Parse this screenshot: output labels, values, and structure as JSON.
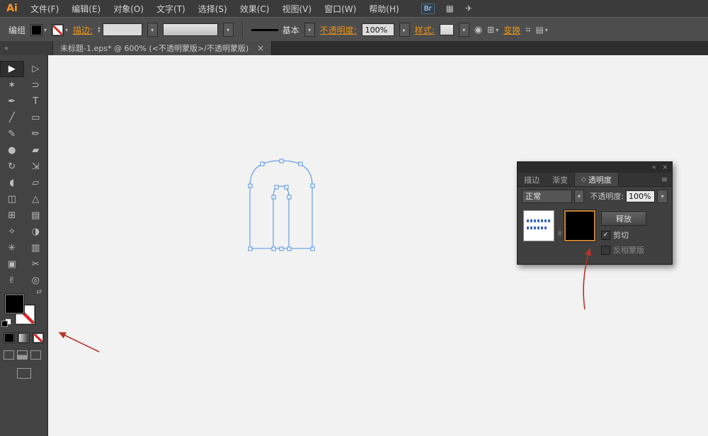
{
  "app": {
    "logo": "Ai",
    "menu": [
      "文件(F)",
      "编辑(E)",
      "对象(O)",
      "文字(T)",
      "选择(S)",
      "效果(C)",
      "视图(V)",
      "窗口(W)",
      "帮助(H)"
    ],
    "bridge": "Br"
  },
  "control_bar": {
    "context": "编组",
    "stroke": "描边:",
    "brush_name": "基本",
    "opacity": "不透明度:",
    "opacity_value": "100%",
    "style": "样式:",
    "transform": "变换"
  },
  "document_tab": {
    "title": "未标题-1.eps* @ 600% (<不透明蒙版>/不透明蒙版)",
    "close": "×"
  },
  "tools": [
    {
      "name": "selection-tool",
      "glyph": "▶",
      "active": true
    },
    {
      "name": "direct-selection-tool",
      "glyph": "▷"
    },
    {
      "name": "magic-wand-tool",
      "glyph": "✶"
    },
    {
      "name": "lasso-tool",
      "glyph": "⊃"
    },
    {
      "name": "pen-tool",
      "glyph": "✒"
    },
    {
      "name": "type-tool",
      "glyph": "T"
    },
    {
      "name": "line-segment-tool",
      "glyph": "╱"
    },
    {
      "name": "rectangle-tool",
      "glyph": "▭"
    },
    {
      "name": "paintbrush-tool",
      "glyph": "✎"
    },
    {
      "name": "pencil-tool",
      "glyph": "✏"
    },
    {
      "name": "blob-brush-tool",
      "glyph": "●"
    },
    {
      "name": "eraser-tool",
      "glyph": "▰"
    },
    {
      "name": "rotate-tool",
      "glyph": "↻"
    },
    {
      "name": "scale-tool",
      "glyph": "⇲"
    },
    {
      "name": "width-tool",
      "glyph": "◖"
    },
    {
      "name": "free-transform-tool",
      "glyph": "▱"
    },
    {
      "name": "shape-builder-tool",
      "glyph": "◫"
    },
    {
      "name": "perspective-grid-tool",
      "glyph": "△"
    },
    {
      "name": "mesh-tool",
      "glyph": "⊞"
    },
    {
      "name": "gradient-tool",
      "glyph": "▤"
    },
    {
      "name": "eyedropper-tool",
      "glyph": "✧"
    },
    {
      "name": "blend-tool",
      "glyph": "◑"
    },
    {
      "name": "symbol-sprayer-tool",
      "glyph": "✳"
    },
    {
      "name": "column-graph-tool",
      "glyph": "▥"
    },
    {
      "name": "artboard-tool",
      "glyph": "▣"
    },
    {
      "name": "slice-tool",
      "glyph": "✂"
    },
    {
      "name": "hand-tool",
      "glyph": "✌"
    },
    {
      "name": "zoom-tool",
      "glyph": "◎"
    }
  ],
  "panel": {
    "tabs": [
      {
        "label": "描边"
      },
      {
        "label": "渐变"
      },
      {
        "label": "透明度",
        "icon": "◇",
        "active": true
      }
    ],
    "blend_mode": "正常",
    "opacity_label": "不透明度:",
    "opacity_value": "100%",
    "release": "释放",
    "clip": "剪切",
    "clip_checked": "✓",
    "invert": "反相蒙版"
  },
  "icons": {
    "collapse": "«",
    "close": "×",
    "panel_menu": "≡",
    "dropdown": "▾",
    "flyout": "▸",
    "spinner_up": "▴",
    "spinner_down": "▾",
    "workspace": "▦",
    "share": "✈",
    "link": "∞",
    "swap": "⇄",
    "recolor": "◉",
    "grid": "⊞",
    "crop": "⌗",
    "menu_more": "▤"
  },
  "colors": {
    "accent_orange": "#e8931c",
    "selection_blue": "#4a90e2",
    "annotation_red": "#b5352a",
    "mask_border": "#c9833c"
  }
}
